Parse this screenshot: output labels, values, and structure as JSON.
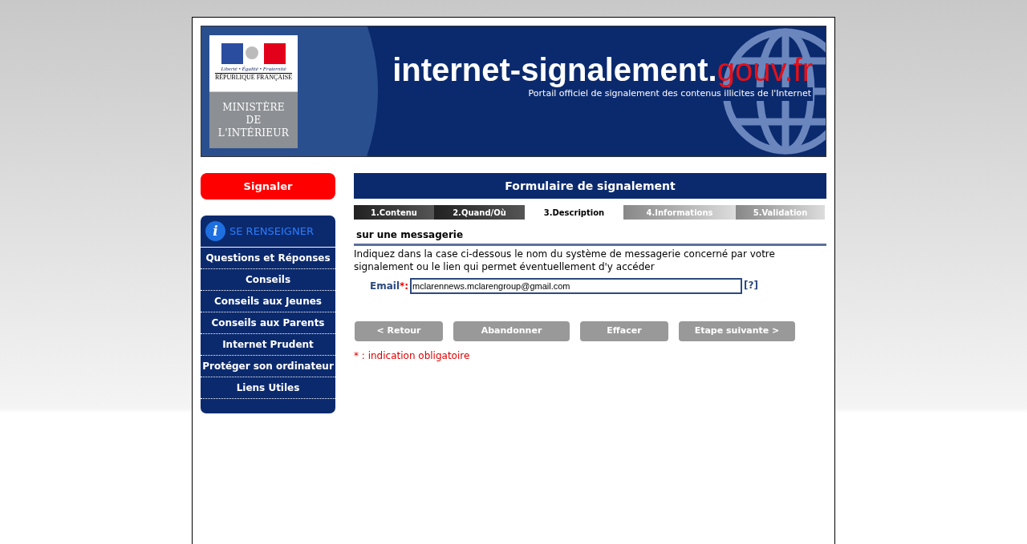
{
  "header": {
    "logo": {
      "motto": "Liberté • Égalité • Fraternité",
      "republic": "RÉPUBLIQUE FRANÇAISE",
      "ministry": [
        "MINISTÈRE",
        "DE",
        "L'INTÉRIEUR"
      ]
    },
    "site_name": "internet-signalement.",
    "site_domain": "gouv.fr",
    "tagline": "Portail officiel de signalement des contenus illicites de l'Internet"
  },
  "sidebar": {
    "report_button": "Signaler",
    "info_icon": "i",
    "info_title": "SE RENSEIGNER",
    "items": [
      "Questions et Réponses",
      "Conseils",
      "Conseils aux Jeunes",
      "Conseils aux Parents",
      "Internet Prudent",
      "Protéger son ordinateur",
      "Liens Utiles"
    ]
  },
  "form": {
    "title": "Formulaire de signalement",
    "steps": [
      {
        "label": "1.Contenu",
        "done": true,
        "selected": false
      },
      {
        "label": "2.Quand/Où",
        "done": true,
        "selected": false
      },
      {
        "label": "3.Description",
        "done": false,
        "selected": true
      },
      {
        "label": "4.Informations",
        "done": false,
        "selected": false
      },
      {
        "label": "5.Validation",
        "done": false,
        "selected": false
      }
    ],
    "section_title": "sur une messagerie",
    "instructions": "Indiquez dans la case ci-dessous le nom du système de messagerie concerné par votre signalement ou le lien qui permet éventuellement d'y accéder",
    "field": {
      "label": "Email",
      "required_mark": "*:",
      "value": "mclarennews.mclarengroup@gmail.com",
      "help": "[?]"
    },
    "buttons": [
      "< Retour",
      "Abandonner",
      "Effacer",
      "Etape suivante >"
    ],
    "footnote": "* : indication obligatoire"
  }
}
